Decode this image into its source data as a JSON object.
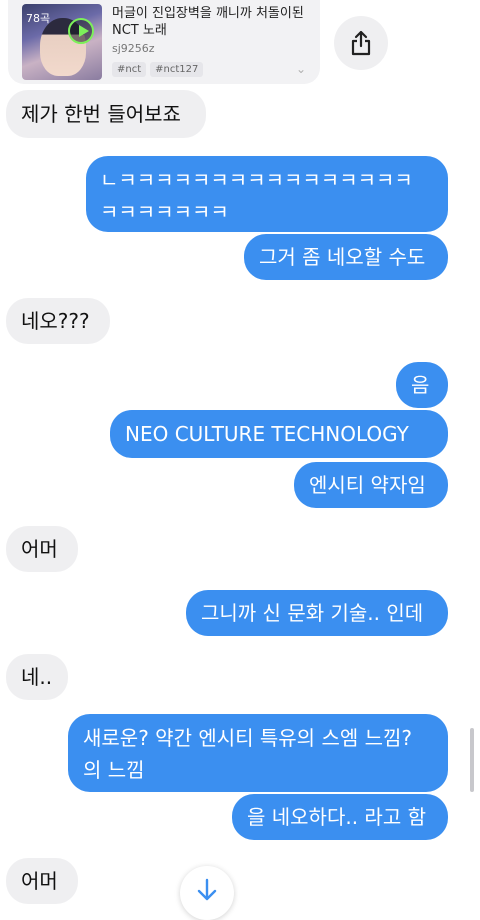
{
  "link_card": {
    "count_label": "78곡",
    "title": "머글이 진입장벽을 깨니까 처돌이된 NCT 노래",
    "author": "sj9256z",
    "tags": [
      "#nct",
      "#nct127"
    ]
  },
  "icons": {
    "share": "share-icon",
    "scroll_down": "arrow-down-icon",
    "play": "play-icon",
    "chevron": "chevron-down-icon"
  },
  "colors": {
    "outgoing": "#3b8ff0",
    "incoming": "#efeff1"
  },
  "messages": [
    {
      "side": "in",
      "text": "제가 한번 들어보죠"
    },
    {
      "side": "out",
      "text": "ㄴㅋㅋㅋㅋㅋㅋㅋㅋㅋㅋㅋㅋㅋㅋㅋㅋ ㅋㅋㅋㅋㅋㅋㅋ"
    },
    {
      "side": "out",
      "text": "그거 좀 네오할 수도"
    },
    {
      "side": "in",
      "text": "네오???"
    },
    {
      "side": "out",
      "text": "음"
    },
    {
      "side": "out",
      "text": "NEO CULTURE TECHNOLOGY"
    },
    {
      "side": "out",
      "text": "엔시티 약자임"
    },
    {
      "side": "in",
      "text": "어머"
    },
    {
      "side": "out",
      "text": "그니까 신 문화 기술.. 인데"
    },
    {
      "side": "in",
      "text": "네.."
    },
    {
      "side": "out",
      "text": "새로운? 약간 엔시티 특유의 스엠 느낌? 의 느낌"
    },
    {
      "side": "out",
      "text": "을 네오하다.. 라고 함"
    },
    {
      "side": "in",
      "text": "어머"
    }
  ]
}
